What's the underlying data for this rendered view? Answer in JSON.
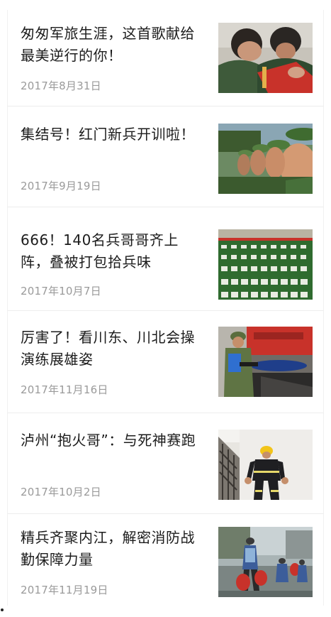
{
  "articles": [
    {
      "title": "匆匆军旅生涯，这首歌献给最美逆行的你！",
      "date": "2017年8月31日",
      "thumb_icon": "soldiers-embrace-photo"
    },
    {
      "title": "集结号！红门新兵开训啦！",
      "date": "2017年9月19日",
      "thumb_icon": "recruits-in-line-photo"
    },
    {
      "title": "666！140名兵哥哥齐上阵，叠被打包拾兵味",
      "date": "2017年10月7日",
      "thumb_icon": "folded-quilts-on-field-photo"
    },
    {
      "title": "厉害了！看川东、川北会操演练展雄姿",
      "date": "2017年11月16日",
      "thumb_icon": "firefighter-drill-photo"
    },
    {
      "title": "泸州“抱火哥”：与死神赛跑",
      "date": "2017年10月2日",
      "thumb_icon": "firefighter-running-photo"
    },
    {
      "title": "精兵齐聚内江，解密消防战勤保障力量",
      "date": "2017年11月19日",
      "thumb_icon": "firefighters-training-photo"
    }
  ]
}
